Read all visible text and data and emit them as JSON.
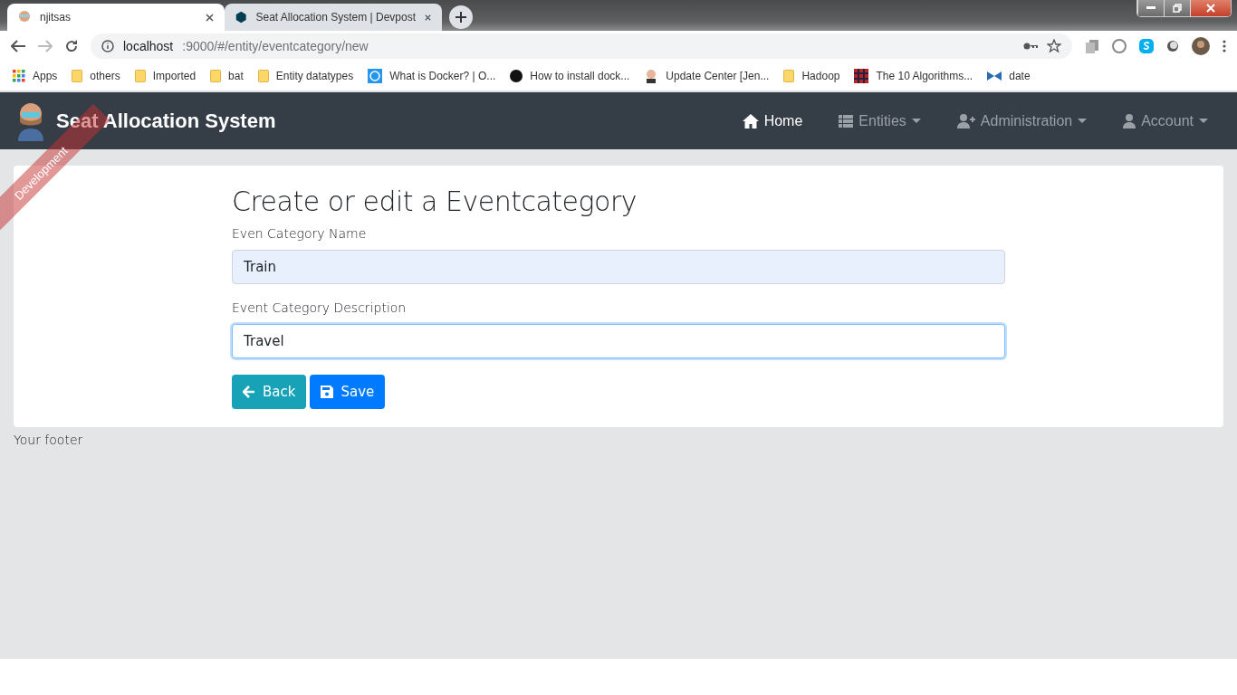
{
  "browser": {
    "tabs": [
      {
        "title": "njitsas",
        "selected": true
      },
      {
        "title": "Seat Allocation System | Devpost",
        "selected": false
      }
    ],
    "address": {
      "host": "localhost",
      "rest": ":9000/#/entity/eventcategory/new"
    },
    "bookmarks": [
      {
        "label": "Apps",
        "kind": "apps"
      },
      {
        "label": "others",
        "kind": "folder"
      },
      {
        "label": "Imported",
        "kind": "folder"
      },
      {
        "label": "bat",
        "kind": "folder"
      },
      {
        "label": "Entity datatypes",
        "kind": "folder"
      },
      {
        "label": "What is Docker? | O...",
        "kind": "site"
      },
      {
        "label": "How to install dock...",
        "kind": "site"
      },
      {
        "label": "Update Center [Jen...",
        "kind": "site"
      },
      {
        "label": "Hadoop",
        "kind": "folder"
      },
      {
        "label": "The 10 Algorithms...",
        "kind": "site"
      },
      {
        "label": "date",
        "kind": "site"
      }
    ]
  },
  "navbar": {
    "brand": "Seat Allocation System",
    "ribbon": "Development",
    "items": [
      {
        "label": "Home",
        "selected": true,
        "dropdown": false
      },
      {
        "label": "Entities",
        "selected": false,
        "dropdown": true
      },
      {
        "label": "Administration",
        "selected": false,
        "dropdown": true
      },
      {
        "label": "Account",
        "selected": false,
        "dropdown": true
      }
    ]
  },
  "form": {
    "title": "Create or edit a Eventcategory",
    "fields": [
      {
        "label": "Even Category Name",
        "value": "Train",
        "autofilled": true,
        "focused": false
      },
      {
        "label": "Event Category Description",
        "value": "Travel",
        "autofilled": false,
        "focused": true
      }
    ],
    "buttons": [
      {
        "label": "Back",
        "kind": "back"
      },
      {
        "label": "Save",
        "kind": "save"
      }
    ]
  },
  "footer": "Your footer"
}
